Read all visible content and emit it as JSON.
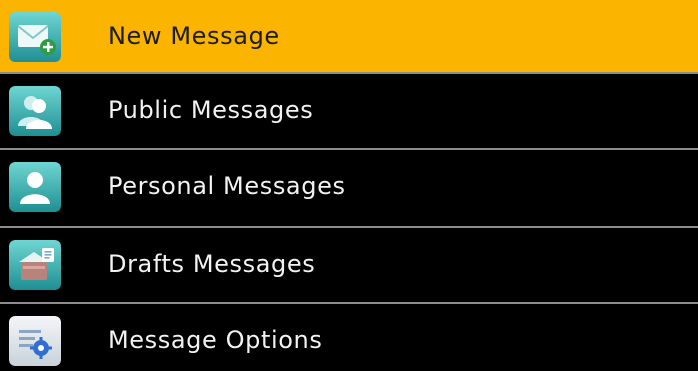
{
  "menu": {
    "items": [
      {
        "label": "New Message",
        "icon": "new-message-icon",
        "selected": true
      },
      {
        "label": "Public Messages",
        "icon": "public-messages-icon",
        "selected": false
      },
      {
        "label": "Personal Messages",
        "icon": "personal-messages-icon",
        "selected": false
      },
      {
        "label": "Drafts Messages",
        "icon": "drafts-messages-icon",
        "selected": false
      },
      {
        "label": "Message Options",
        "icon": "message-options-icon",
        "selected": false
      }
    ]
  },
  "colors": {
    "selected_background": "#fbb400",
    "background": "#000000",
    "divider": "#8c8c8c",
    "text": "#f2f2f2",
    "icon_teal": "#38b0b0"
  }
}
